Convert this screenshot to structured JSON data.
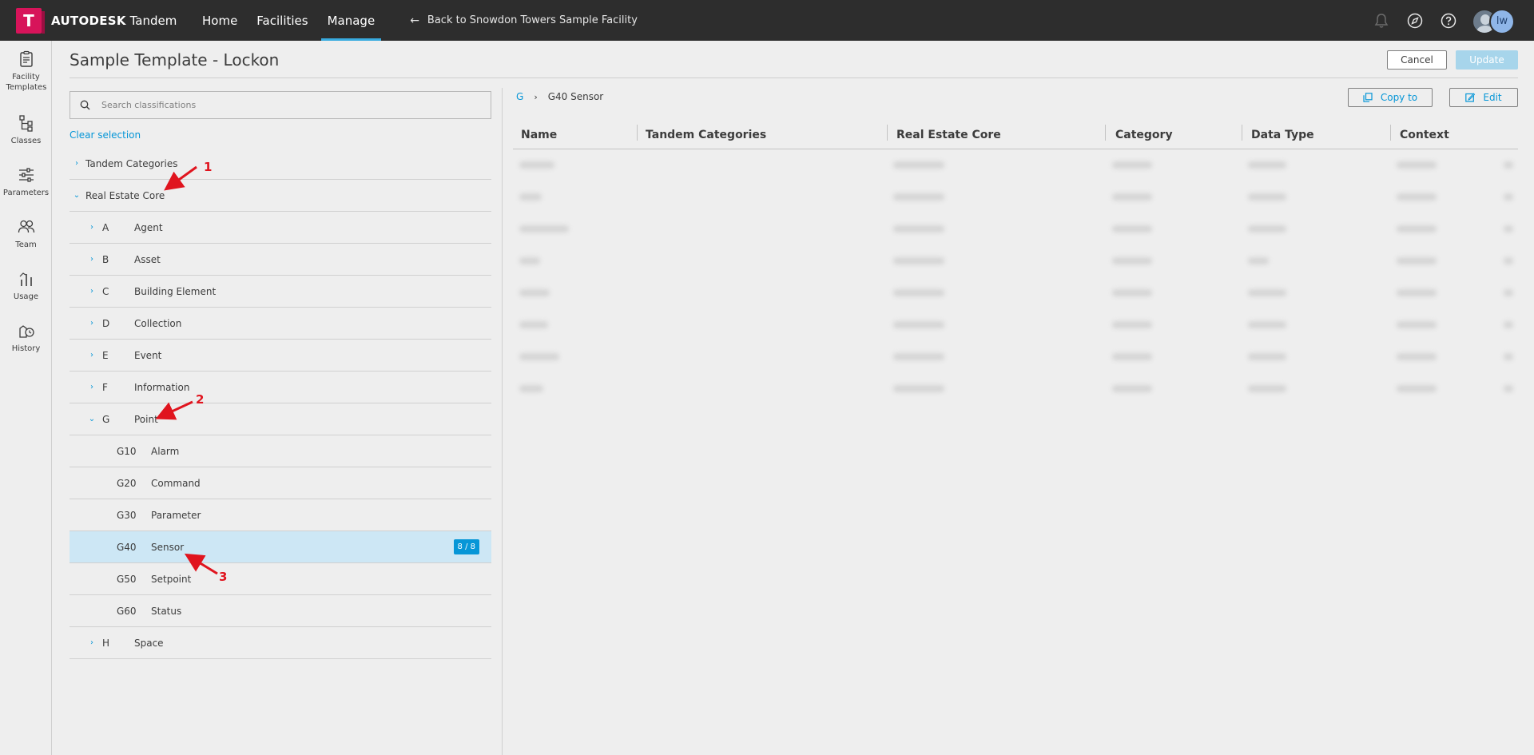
{
  "app": {
    "brand": "AUTODESK",
    "product": "Tandem",
    "nav": [
      {
        "label": "Home",
        "active": false
      },
      {
        "label": "Facilities",
        "active": false
      },
      {
        "label": "Manage",
        "active": true
      }
    ],
    "back_link": "Back to Snowdon Towers Sample Facility",
    "user_initials": "lw",
    "colors": {
      "accent": "#0696d7",
      "topbar": "#2d2d2d",
      "brand": "#d7145a",
      "selected_row": "#cde7f5"
    }
  },
  "sidebar": {
    "items": [
      {
        "label": "Facility Templates",
        "icon": "clipboard-icon"
      },
      {
        "label": "Classes",
        "icon": "hierarchy-icon"
      },
      {
        "label": "Parameters",
        "icon": "sliders-icon"
      },
      {
        "label": "Team",
        "icon": "people-icon"
      },
      {
        "label": "Usage",
        "icon": "chart-icon"
      },
      {
        "label": "History",
        "icon": "history-icon"
      }
    ]
  },
  "page": {
    "title": "Sample Template - Lockon",
    "cancel_label": "Cancel",
    "update_label": "Update"
  },
  "left_panel": {
    "search_placeholder": "Search classifications",
    "clear_selection": "Clear selection",
    "tree": [
      {
        "code": "",
        "label": "Tandem Categories",
        "expanded": false,
        "level": 0
      },
      {
        "code": "",
        "label": "Real Estate Core",
        "expanded": true,
        "level": 0
      },
      {
        "code": "A",
        "label": "Agent",
        "expanded": false,
        "level": 1
      },
      {
        "code": "B",
        "label": "Asset",
        "expanded": false,
        "level": 1
      },
      {
        "code": "C",
        "label": "Building Element",
        "expanded": false,
        "level": 1
      },
      {
        "code": "D",
        "label": "Collection",
        "expanded": false,
        "level": 1
      },
      {
        "code": "E",
        "label": "Event",
        "expanded": false,
        "level": 1
      },
      {
        "code": "F",
        "label": "Information",
        "expanded": false,
        "level": 1
      },
      {
        "code": "G",
        "label": "Point",
        "expanded": true,
        "level": 1
      },
      {
        "code": "G10",
        "label": "Alarm",
        "level": 2
      },
      {
        "code": "G20",
        "label": "Command",
        "level": 2
      },
      {
        "code": "G30",
        "label": "Parameter",
        "level": 2
      },
      {
        "code": "G40",
        "label": "Sensor",
        "level": 2,
        "selected": true,
        "badge": "8 / 8"
      },
      {
        "code": "G50",
        "label": "Setpoint",
        "level": 2
      },
      {
        "code": "G60",
        "label": "Status",
        "level": 2
      },
      {
        "code": "H",
        "label": "Space",
        "expanded": false,
        "level": 1
      }
    ]
  },
  "annotations": [
    "1",
    "2",
    "3"
  ],
  "right_panel": {
    "breadcrumb_root": "G",
    "breadcrumb_current": "G40 Sensor",
    "copy_label": "Copy to",
    "edit_label": "Edit",
    "columns": [
      "Name",
      "Tandem Categories",
      "Real Estate Core",
      "Category",
      "Data Type",
      "Context"
    ],
    "row_count": 8
  }
}
